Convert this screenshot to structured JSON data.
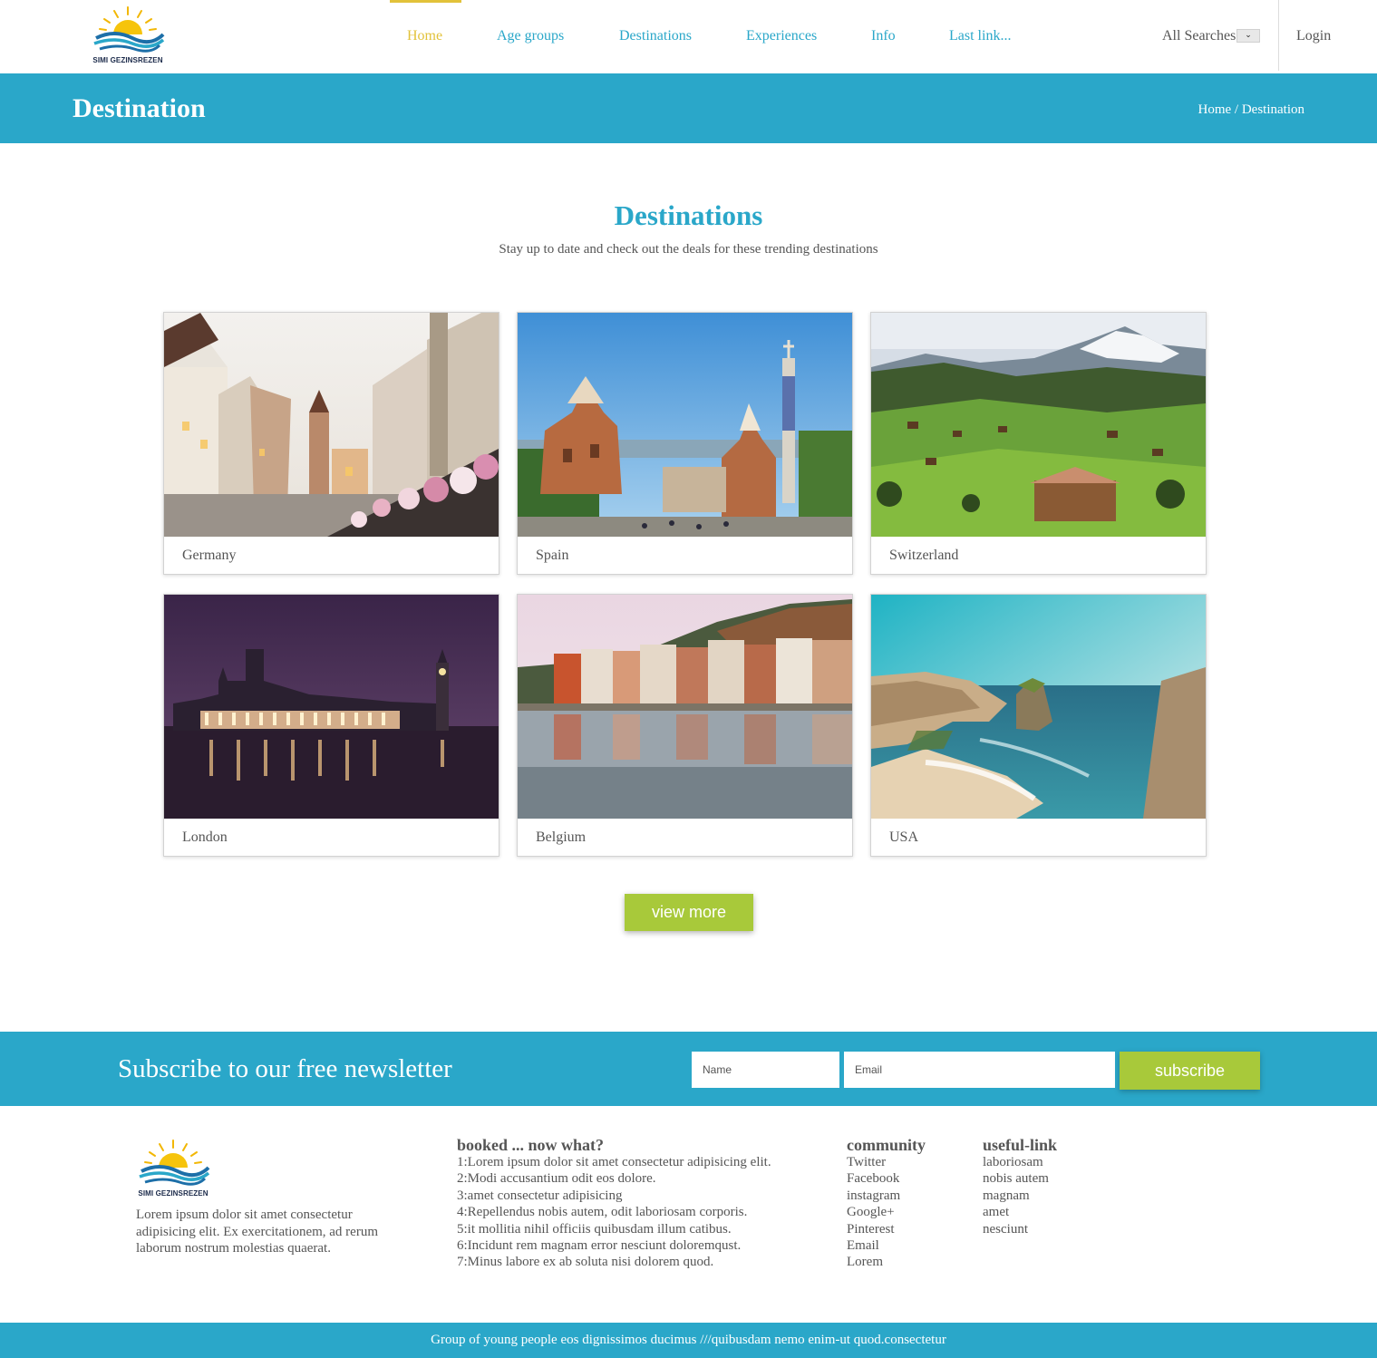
{
  "brand": {
    "logo_text": "SIMI GEZINSREZEN"
  },
  "nav": {
    "items": [
      {
        "label": "Home",
        "active": true
      },
      {
        "label": "Age groups",
        "active": false
      },
      {
        "label": "Destinations",
        "active": false
      },
      {
        "label": "Experiences",
        "active": false
      },
      {
        "label": "Info",
        "active": false
      },
      {
        "label": "Last link...",
        "active": false
      }
    ],
    "search_select": "All Searches",
    "login": "Login"
  },
  "banner": {
    "title": "Destination",
    "breadcrumb_home": "Home",
    "breadcrumb_sep": " / ",
    "breadcrumb_current": "Destination"
  },
  "destinations": {
    "title": "Destinations",
    "subtitle": "Stay up to date and check out the deals for these trending destinations",
    "cards": [
      {
        "label": "Germany"
      },
      {
        "label": "Spain"
      },
      {
        "label": "Switzerland"
      },
      {
        "label": "London"
      },
      {
        "label": "Belgium"
      },
      {
        "label": "USA"
      }
    ],
    "view_more": "view more"
  },
  "newsletter": {
    "title": "Subscribe to our free newsletter",
    "name_placeholder": "Name",
    "email_placeholder": "Email",
    "button": "subscribe"
  },
  "footer": {
    "about": "Lorem ipsum dolor sit amet consectetur adipisicing elit. Ex exercitationem, ad rerum laborum nostrum molestias quaerat.",
    "booked": {
      "title": "booked ... now what?",
      "items": [
        "1:Lorem ipsum dolor sit amet consectetur adipisicing elit.",
        "2:Modi accusantium odit eos dolore.",
        "3:amet consectetur adipisicing",
        "4:Repellendus nobis autem, odit laboriosam corporis.",
        "5:it mollitia nihil officiis quibusdam illum catibus.",
        "6:Incidunt rem magnam error nesciunt doloremqust.",
        "7:Minus labore ex ab soluta nisi dolorem quod."
      ]
    },
    "community": {
      "title": "community",
      "items": [
        "Twitter",
        "Facebook",
        "instagram",
        "Google+",
        "Pinterest",
        "Email",
        "Lorem"
      ]
    },
    "useful": {
      "title": "useful-link",
      "items": [
        "laboriosam",
        "nobis autem",
        "magnam",
        "amet",
        "nesciunt"
      ]
    },
    "copyright": "Group of young people eos dignissimos ducimus ///quibusdam nemo enim-ut quod.consectetur"
  }
}
